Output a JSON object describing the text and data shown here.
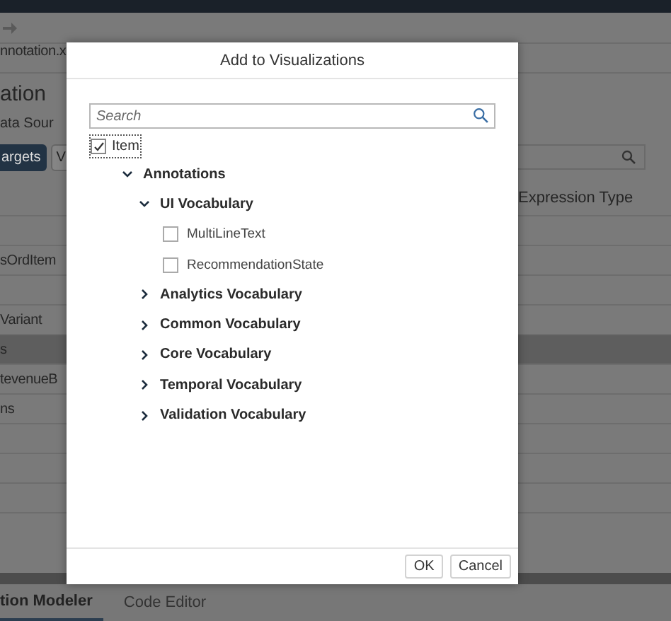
{
  "background": {
    "file_tab": "nnotation.x",
    "heading": "ation",
    "data_source": "ata Sour",
    "buttons": [
      {
        "label": "argets",
        "selected": true
      },
      {
        "label": "V",
        "selected": false
      }
    ],
    "column_header": "Expression Type",
    "rows": [
      {
        "label": "",
        "selected": false
      },
      {
        "label": "sOrdItem",
        "selected": false
      },
      {
        "label": "",
        "selected": false
      },
      {
        "label": "Variant",
        "selected": false
      },
      {
        "label": "s",
        "selected": true
      },
      {
        "label": "tevenueB",
        "selected": false
      },
      {
        "label": "ns",
        "selected": false
      },
      {
        "label": "",
        "selected": false
      },
      {
        "label": "",
        "selected": false
      },
      {
        "label": "",
        "selected": false
      }
    ],
    "bottom_tabs": [
      {
        "label": "tion Modeler",
        "selected": true
      },
      {
        "label": "Code Editor",
        "selected": false
      }
    ]
  },
  "dialog": {
    "title": "Add to Visualizations",
    "search": {
      "placeholder": "Search"
    },
    "root": {
      "label": "Item",
      "checked": true,
      "focused": true
    },
    "tree": [
      {
        "label": "Annotations",
        "expanded": true,
        "children": [
          {
            "label": "UI Vocabulary",
            "expanded": true,
            "children": [
              {
                "label": "MultiLineText",
                "checked": false
              },
              {
                "label": "RecommendationState",
                "checked": false
              }
            ]
          },
          {
            "label": "Analytics Vocabulary",
            "expanded": false
          },
          {
            "label": "Common Vocabulary",
            "expanded": false
          },
          {
            "label": "Core Vocabulary",
            "expanded": false
          },
          {
            "label": "Temporal Vocabulary",
            "expanded": false
          },
          {
            "label": "Validation Vocabulary",
            "expanded": false
          }
        ]
      }
    ],
    "buttons": [
      "OK",
      "Cancel"
    ]
  }
}
